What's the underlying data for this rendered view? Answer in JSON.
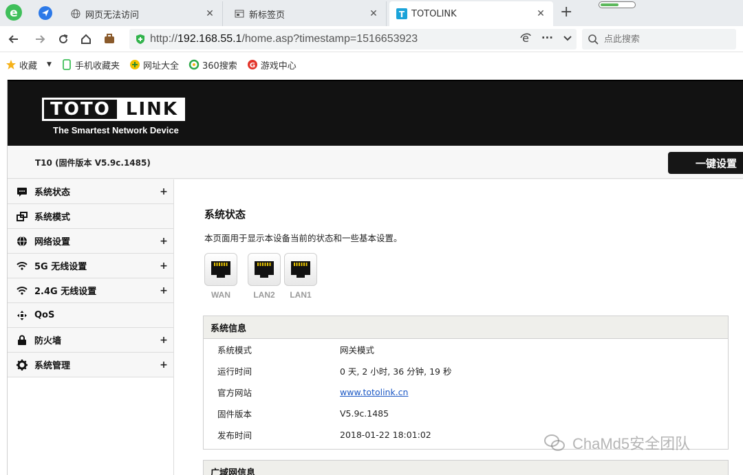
{
  "browser": {
    "tabs": [
      {
        "title": "网页无法访问",
        "icon": "globe-icon"
      },
      {
        "title": "新标签页",
        "icon": "window-icon"
      },
      {
        "title": "TOTOLINK",
        "icon": "totolink-favicon"
      }
    ],
    "new_tab_symbol": "+",
    "close_symbol": "✕",
    "address": {
      "prefix": "http://",
      "host": "192.168.55.1",
      "path": "/home.asp?timestamp=1516653923"
    },
    "more_symbol": "···",
    "search_placeholder": "点此搜索",
    "bookmarks": [
      {
        "label": "收藏",
        "icon": "star-icon"
      },
      {
        "label": "手机收藏夹",
        "icon": "phone-icon"
      },
      {
        "label": "网址大全",
        "icon": "url-nav-icon"
      },
      {
        "label": "360搜索",
        "icon": "360-search-icon"
      },
      {
        "label": "游戏中心",
        "icon": "game-center-icon"
      }
    ],
    "accent_color": "#2c79e8"
  },
  "router": {
    "brand_left": "TOTO",
    "brand_right": "LINK",
    "tagline": "The Smartest Network Device",
    "firmware_line": "T10 (固件版本 V5.9c.1485)",
    "quick_setup": "一键设置",
    "menu": [
      {
        "label": "系统状态",
        "icon": "status-icon",
        "expand": "+"
      },
      {
        "label": "系统模式",
        "icon": "mode-icon",
        "expand": ""
      },
      {
        "label": "网络设置",
        "icon": "network-globe-icon",
        "expand": "+"
      },
      {
        "label": "5G 无线设置",
        "icon": "wifi-icon",
        "expand": "+"
      },
      {
        "label": "2.4G 无线设置",
        "icon": "wifi-icon",
        "expand": "+"
      },
      {
        "label": "QoS",
        "icon": "qos-icon",
        "expand": ""
      },
      {
        "label": "防火墙",
        "icon": "lock-icon",
        "expand": "+"
      },
      {
        "label": "系统管理",
        "icon": "gear-icon",
        "expand": "+"
      }
    ],
    "page_title": "系统状态",
    "page_desc": "本页面用于显示本设备当前的状态和一些基本设置。",
    "ports": [
      {
        "label": "WAN"
      },
      {
        "label": "LAN2"
      },
      {
        "label": "LAN1"
      }
    ],
    "sysinfo": {
      "title": "系统信息",
      "rows": [
        {
          "key": "系统模式",
          "value": "网关模式"
        },
        {
          "key": "运行时间",
          "value": "0 天, 2 小时, 36 分钟, 19 秒"
        },
        {
          "key": "官方网站",
          "value": "www.totolink.cn"
        },
        {
          "key": "固件版本",
          "value": "V5.9c.1485"
        },
        {
          "key": "发布时间",
          "value": "2018-01-22 18:01:02"
        }
      ]
    },
    "lan_title": "广域网信息"
  },
  "watermark": "ChaMd5安全团队"
}
